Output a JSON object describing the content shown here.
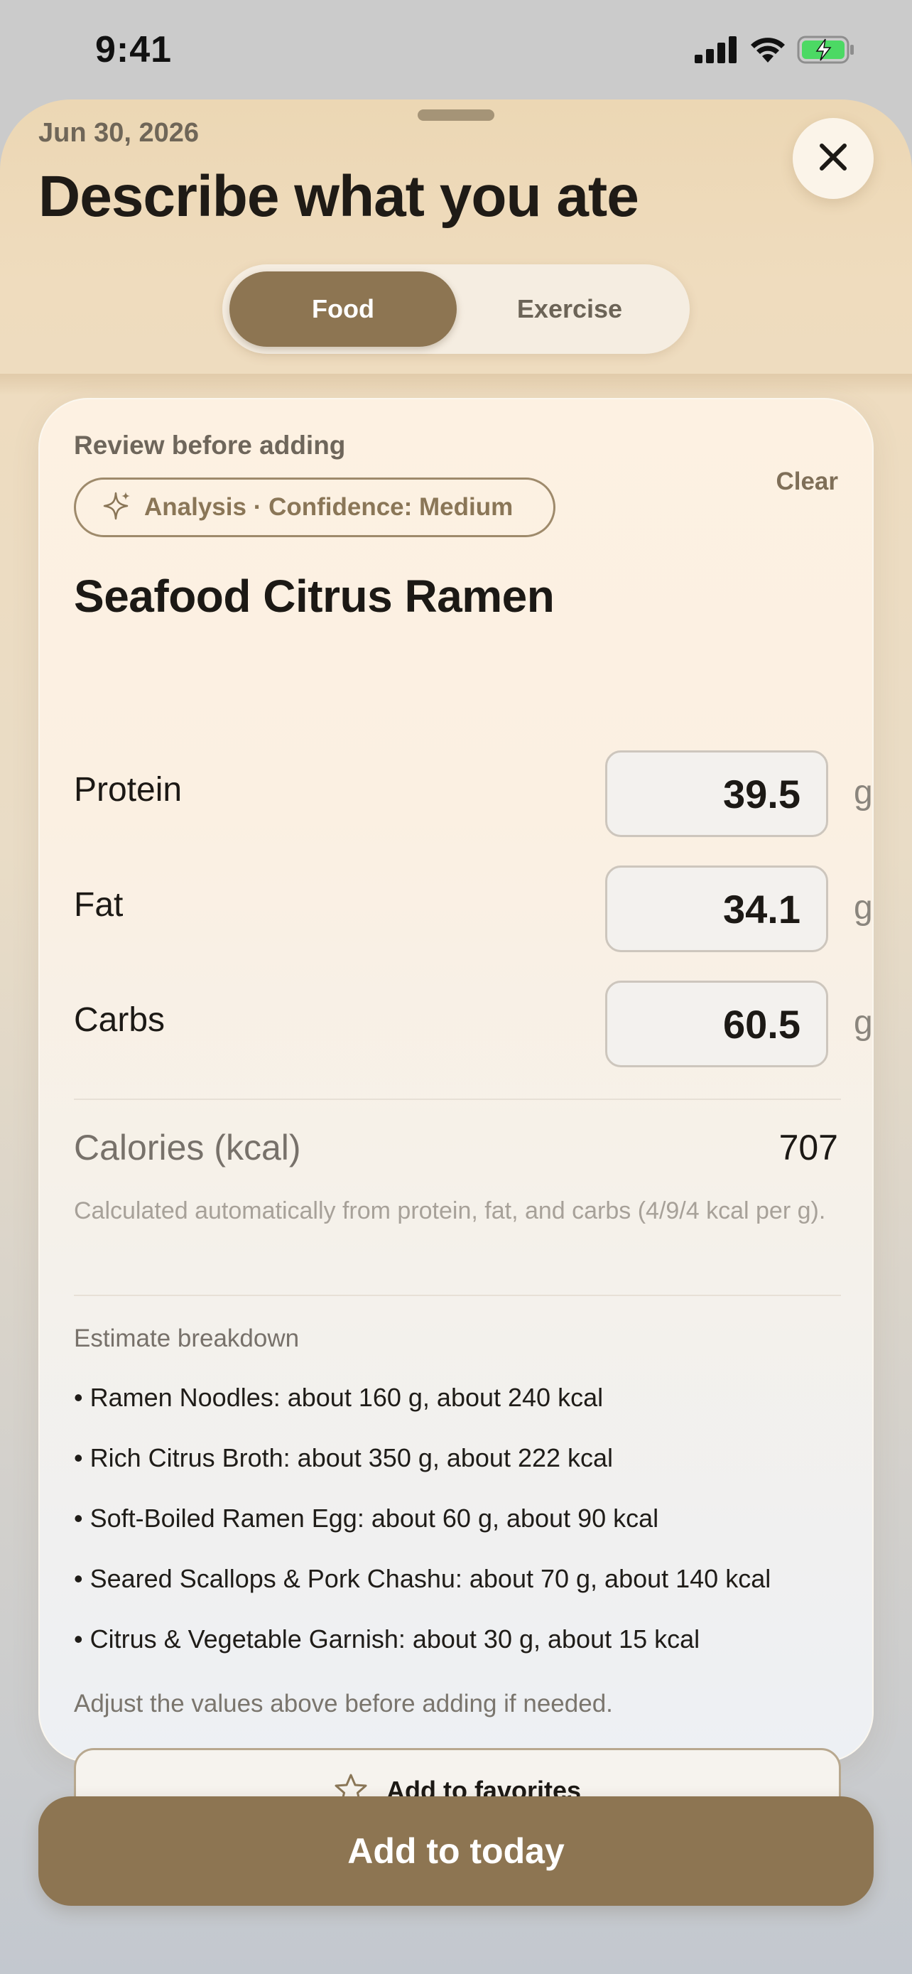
{
  "status_bar": {
    "time": "9:41"
  },
  "header": {
    "date": "Jun 30, 2026",
    "title": "Describe what you ate"
  },
  "segmented_control": {
    "options": [
      "Food",
      "Exercise"
    ],
    "selected": "Food"
  },
  "review": {
    "label": "Review before adding",
    "clear_label": "Clear",
    "analysis_chip": "Analysis · Confidence: Medium",
    "food_name": "Seafood Citrus Ramen"
  },
  "macros": [
    {
      "label": "Protein",
      "value": "39.5",
      "unit": "g"
    },
    {
      "label": "Fat",
      "value": "34.1",
      "unit": "g"
    },
    {
      "label": "Carbs",
      "value": "60.5",
      "unit": "g"
    }
  ],
  "calories": {
    "label": "Calories (kcal)",
    "value": "707",
    "note": "Calculated automatically from protein, fat, and carbs (4/9/4 kcal per g)."
  },
  "breakdown": {
    "title": "Estimate breakdown",
    "items": [
      "• Ramen Noodles: about 160 g, about 240 kcal",
      "• Rich Citrus Broth: about 350 g, about 222 kcal",
      "• Soft-Boiled Ramen Egg: about 60 g, about 90 kcal",
      "• Seared Scallops & Pork Chashu: about 70 g, about 140 kcal",
      "• Citrus & Vegetable Garnish: about 30 g, about 15 kcal"
    ],
    "adjust_note": "Adjust the values above before adding if needed."
  },
  "buttons": {
    "favorites_label": "Add to favorites",
    "add_today_label": "Add to today"
  },
  "colors": {
    "accent": "#8d7552",
    "chip_border": "#9e8a6b",
    "battery_fill": "#4cd964"
  },
  "icons": [
    "signal-icon",
    "wifi-icon",
    "battery-charging-icon",
    "close-icon",
    "sparkle-icon",
    "star-icon"
  ]
}
